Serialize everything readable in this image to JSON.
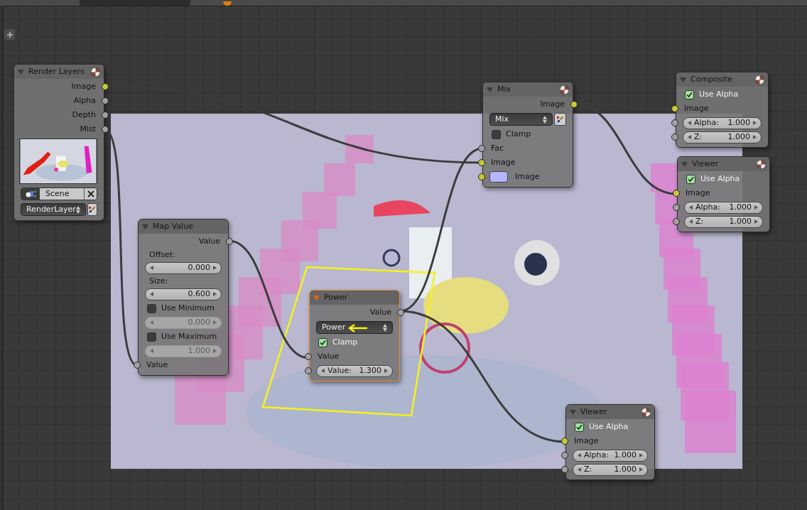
{
  "nodes": [
    {
      "title": "Render Layers",
      "selected": false,
      "sphere_icon": true,
      "rows": [
        {
          "kind": "output",
          "label": "Image",
          "color": "#c8c83a"
        },
        {
          "kind": "output",
          "label": "Alpha",
          "color": "#a1a1a1"
        },
        {
          "kind": "output",
          "label": "Depth",
          "color": "#a1a1a1"
        },
        {
          "kind": "output",
          "label": "Mist",
          "color": "#a1a1a1"
        },
        {
          "kind": "preview"
        },
        {
          "kind": "datablock",
          "label": "Scene"
        },
        {
          "kind": "dropdown",
          "label": "RenderLayer",
          "extra_button": true
        }
      ]
    },
    {
      "title": "Map Value",
      "selected": false,
      "sphere_icon": false,
      "rows": [
        {
          "kind": "output",
          "label": "Value",
          "color": "#a1a1a1"
        },
        {
          "kind": "label",
          "label": "Offset:"
        },
        {
          "kind": "number",
          "value": "0.000",
          "disabled": false
        },
        {
          "kind": "label",
          "label": "Size:"
        },
        {
          "kind": "number",
          "value": "0.600",
          "disabled": false
        },
        {
          "kind": "checkbox",
          "label": "Use Minimum",
          "checked": false
        },
        {
          "kind": "number",
          "value": "0.000",
          "disabled": true
        },
        {
          "kind": "checkbox",
          "label": "Use Maximum",
          "checked": false
        },
        {
          "kind": "number",
          "value": "1.000",
          "disabled": true
        },
        {
          "kind": "input",
          "label": "Value",
          "color": "#a1a1a1"
        }
      ]
    },
    {
      "title": "Power",
      "selected": true,
      "sphere_icon": false,
      "rows": [
        {
          "kind": "output",
          "label": "Value",
          "color": "#a1a1a1"
        },
        {
          "kind": "dropdown",
          "label": "Power",
          "extra_button": false
        },
        {
          "kind": "checkbox",
          "label": "Clamp",
          "checked": true
        },
        {
          "kind": "input",
          "label": "Value",
          "color": "#a1a1a1"
        },
        {
          "kind": "number",
          "label": "Value:",
          "value": "1.300",
          "disabled": false,
          "color": "#a1a1a1"
        }
      ]
    },
    {
      "title": "Mix",
      "selected": false,
      "sphere_icon": true,
      "rows": [
        {
          "kind": "output",
          "label": "Image",
          "color": "#c8c83a"
        },
        {
          "kind": "dropdown",
          "label": "Mix",
          "extra_button": true
        },
        {
          "kind": "checkbox",
          "label": "Clamp",
          "checked": false
        },
        {
          "kind": "input",
          "label": "Fac",
          "color": "#a1a1a1"
        },
        {
          "kind": "input",
          "label": "Image",
          "color": "#c8c83a"
        },
        {
          "kind": "color_input",
          "label": "Image",
          "color": "#c8c83a",
          "swatch": {
            "color": "#b8b4ff"
          }
        }
      ]
    },
    {
      "title": "Composite",
      "selected": false,
      "sphere_icon": true,
      "rows": [
        {
          "kind": "checkbox",
          "label": "Use Alpha",
          "checked": true
        },
        {
          "kind": "input",
          "label": "Image",
          "color": "#c8c83a"
        },
        {
          "kind": "number",
          "label": "Alpha:",
          "value": "1.000",
          "disabled": false,
          "color": "#a1a1a1"
        },
        {
          "kind": "number",
          "label": "Z:",
          "value": "1.000",
          "disabled": false,
          "color": "#a1a1a1"
        }
      ]
    },
    {
      "title": "Viewer",
      "selected": false,
      "sphere_icon": true,
      "rows": [
        {
          "kind": "checkbox",
          "label": "Use Alpha",
          "checked": true
        },
        {
          "kind": "input",
          "label": "Image",
          "color": "#c8c83a"
        },
        {
          "kind": "number",
          "label": "Alpha:",
          "value": "1.000",
          "disabled": false,
          "color": "#a1a1a1"
        },
        {
          "kind": "number",
          "label": "Z:",
          "value": "1.000",
          "disabled": false,
          "color": "#a1a1a1"
        }
      ]
    },
    {
      "title": "Viewer",
      "selected": false,
      "sphere_icon": true,
      "rows": [
        {
          "kind": "checkbox",
          "label": "Use Alpha",
          "checked": true
        },
        {
          "kind": "input",
          "label": "Image",
          "color": "#c8c83a"
        },
        {
          "kind": "number",
          "label": "Alpha:",
          "value": "1.000",
          "disabled": false,
          "color": "#a1a1a1"
        },
        {
          "kind": "number",
          "label": "Z:",
          "value": "1.000",
          "disabled": false,
          "color": "#a1a1a1"
        }
      ]
    }
  ]
}
